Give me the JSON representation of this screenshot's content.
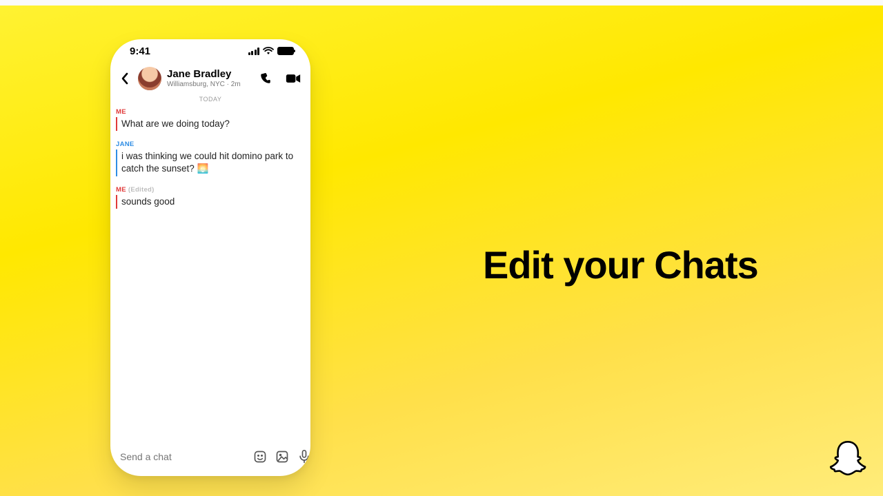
{
  "headline": "Edit your Chats",
  "status": {
    "time": "9:41"
  },
  "header": {
    "contact_name": "Jane Bradley",
    "contact_sub": "Williamsburg, NYC · 2m"
  },
  "date_divider": "TODAY",
  "messages": [
    {
      "label": "ME",
      "body": "What are we doing today?"
    },
    {
      "label": "JANE",
      "body": "i was thinking we could hit domino park to catch the sunset? 🌅"
    },
    {
      "label": "ME",
      "edited": "(Edited)",
      "body": "sounds good"
    }
  ],
  "input": {
    "placeholder": "Send a chat"
  }
}
